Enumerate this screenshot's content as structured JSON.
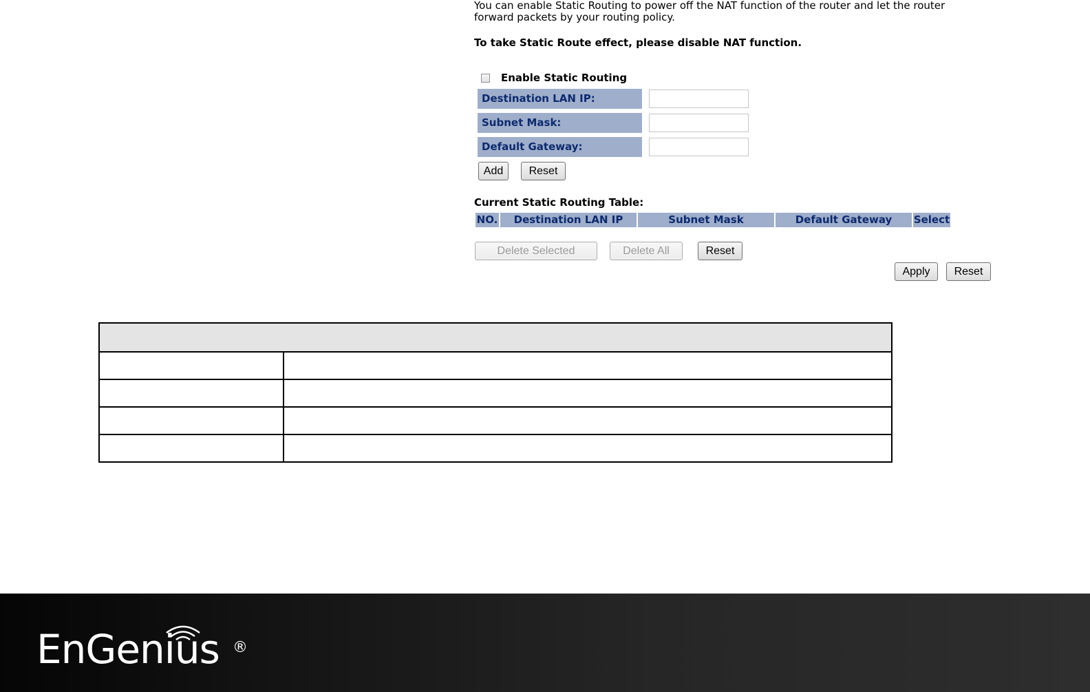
{
  "intro_text": "You can enable Static Routing to power off the NAT function of the router and let the router forward packets by your routing policy.",
  "warning_text": "To take Static Route effect, please disable NAT function.",
  "enable_static_routing": {
    "label": "Enable Static Routing",
    "checked": false
  },
  "fields": [
    {
      "label": "Destination LAN IP:",
      "value": ""
    },
    {
      "label": "Subnet Mask:",
      "value": ""
    },
    {
      "label": "Default Gateway:",
      "value": ""
    }
  ],
  "form_buttons": {
    "add": "Add",
    "reset": "Reset"
  },
  "routing_table": {
    "title": "Current Static Routing Table:",
    "columns": [
      "NO.",
      "Destination LAN IP",
      "Subnet Mask",
      "Default Gateway",
      "Select"
    ]
  },
  "table_buttons": {
    "delete_selected": "Delete Selected",
    "delete_all": "Delete All",
    "reset": "Reset"
  },
  "page_buttons": {
    "apply": "Apply",
    "reset": "Reset"
  },
  "footer": {
    "brand": "EnGenius",
    "registered": "®"
  },
  "colors": {
    "label_bg": "#9eaecb",
    "label_text": "#0d2a6e",
    "footer_bg": "#1c1c1c"
  }
}
